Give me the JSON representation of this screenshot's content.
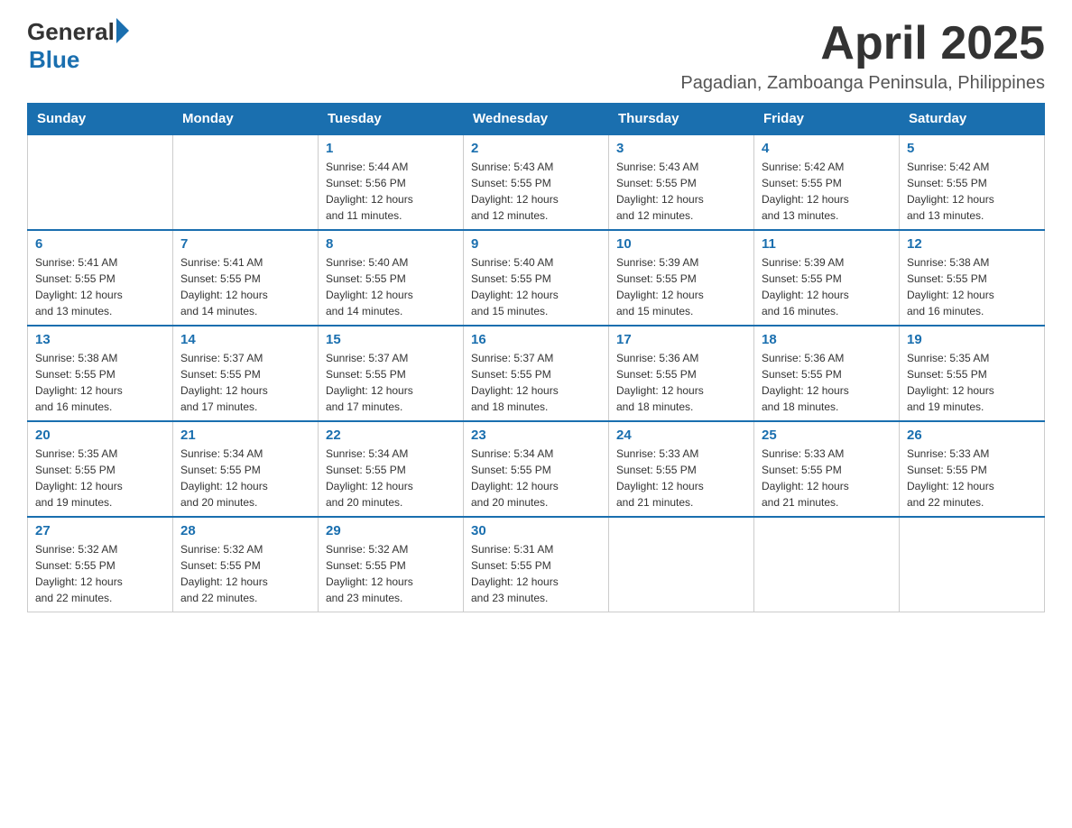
{
  "header": {
    "logo": {
      "general": "General",
      "blue": "Blue"
    },
    "title": "April 2025",
    "location": "Pagadian, Zamboanga Peninsula, Philippines"
  },
  "calendar": {
    "days_of_week": [
      "Sunday",
      "Monday",
      "Tuesday",
      "Wednesday",
      "Thursday",
      "Friday",
      "Saturday"
    ],
    "weeks": [
      [
        {
          "day": "",
          "info": ""
        },
        {
          "day": "",
          "info": ""
        },
        {
          "day": "1",
          "info": "Sunrise: 5:44 AM\nSunset: 5:56 PM\nDaylight: 12 hours\nand 11 minutes."
        },
        {
          "day": "2",
          "info": "Sunrise: 5:43 AM\nSunset: 5:55 PM\nDaylight: 12 hours\nand 12 minutes."
        },
        {
          "day": "3",
          "info": "Sunrise: 5:43 AM\nSunset: 5:55 PM\nDaylight: 12 hours\nand 12 minutes."
        },
        {
          "day": "4",
          "info": "Sunrise: 5:42 AM\nSunset: 5:55 PM\nDaylight: 12 hours\nand 13 minutes."
        },
        {
          "day": "5",
          "info": "Sunrise: 5:42 AM\nSunset: 5:55 PM\nDaylight: 12 hours\nand 13 minutes."
        }
      ],
      [
        {
          "day": "6",
          "info": "Sunrise: 5:41 AM\nSunset: 5:55 PM\nDaylight: 12 hours\nand 13 minutes."
        },
        {
          "day": "7",
          "info": "Sunrise: 5:41 AM\nSunset: 5:55 PM\nDaylight: 12 hours\nand 14 minutes."
        },
        {
          "day": "8",
          "info": "Sunrise: 5:40 AM\nSunset: 5:55 PM\nDaylight: 12 hours\nand 14 minutes."
        },
        {
          "day": "9",
          "info": "Sunrise: 5:40 AM\nSunset: 5:55 PM\nDaylight: 12 hours\nand 15 minutes."
        },
        {
          "day": "10",
          "info": "Sunrise: 5:39 AM\nSunset: 5:55 PM\nDaylight: 12 hours\nand 15 minutes."
        },
        {
          "day": "11",
          "info": "Sunrise: 5:39 AM\nSunset: 5:55 PM\nDaylight: 12 hours\nand 16 minutes."
        },
        {
          "day": "12",
          "info": "Sunrise: 5:38 AM\nSunset: 5:55 PM\nDaylight: 12 hours\nand 16 minutes."
        }
      ],
      [
        {
          "day": "13",
          "info": "Sunrise: 5:38 AM\nSunset: 5:55 PM\nDaylight: 12 hours\nand 16 minutes."
        },
        {
          "day": "14",
          "info": "Sunrise: 5:37 AM\nSunset: 5:55 PM\nDaylight: 12 hours\nand 17 minutes."
        },
        {
          "day": "15",
          "info": "Sunrise: 5:37 AM\nSunset: 5:55 PM\nDaylight: 12 hours\nand 17 minutes."
        },
        {
          "day": "16",
          "info": "Sunrise: 5:37 AM\nSunset: 5:55 PM\nDaylight: 12 hours\nand 18 minutes."
        },
        {
          "day": "17",
          "info": "Sunrise: 5:36 AM\nSunset: 5:55 PM\nDaylight: 12 hours\nand 18 minutes."
        },
        {
          "day": "18",
          "info": "Sunrise: 5:36 AM\nSunset: 5:55 PM\nDaylight: 12 hours\nand 18 minutes."
        },
        {
          "day": "19",
          "info": "Sunrise: 5:35 AM\nSunset: 5:55 PM\nDaylight: 12 hours\nand 19 minutes."
        }
      ],
      [
        {
          "day": "20",
          "info": "Sunrise: 5:35 AM\nSunset: 5:55 PM\nDaylight: 12 hours\nand 19 minutes."
        },
        {
          "day": "21",
          "info": "Sunrise: 5:34 AM\nSunset: 5:55 PM\nDaylight: 12 hours\nand 20 minutes."
        },
        {
          "day": "22",
          "info": "Sunrise: 5:34 AM\nSunset: 5:55 PM\nDaylight: 12 hours\nand 20 minutes."
        },
        {
          "day": "23",
          "info": "Sunrise: 5:34 AM\nSunset: 5:55 PM\nDaylight: 12 hours\nand 20 minutes."
        },
        {
          "day": "24",
          "info": "Sunrise: 5:33 AM\nSunset: 5:55 PM\nDaylight: 12 hours\nand 21 minutes."
        },
        {
          "day": "25",
          "info": "Sunrise: 5:33 AM\nSunset: 5:55 PM\nDaylight: 12 hours\nand 21 minutes."
        },
        {
          "day": "26",
          "info": "Sunrise: 5:33 AM\nSunset: 5:55 PM\nDaylight: 12 hours\nand 22 minutes."
        }
      ],
      [
        {
          "day": "27",
          "info": "Sunrise: 5:32 AM\nSunset: 5:55 PM\nDaylight: 12 hours\nand 22 minutes."
        },
        {
          "day": "28",
          "info": "Sunrise: 5:32 AM\nSunset: 5:55 PM\nDaylight: 12 hours\nand 22 minutes."
        },
        {
          "day": "29",
          "info": "Sunrise: 5:32 AM\nSunset: 5:55 PM\nDaylight: 12 hours\nand 23 minutes."
        },
        {
          "day": "30",
          "info": "Sunrise: 5:31 AM\nSunset: 5:55 PM\nDaylight: 12 hours\nand 23 minutes."
        },
        {
          "day": "",
          "info": ""
        },
        {
          "day": "",
          "info": ""
        },
        {
          "day": "",
          "info": ""
        }
      ]
    ]
  }
}
